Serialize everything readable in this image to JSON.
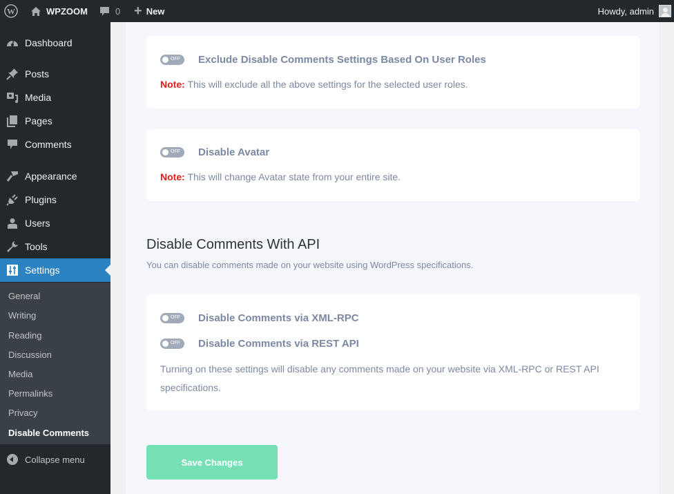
{
  "adminbar": {
    "site_name": "WPZOOM",
    "comments_count": "0",
    "new_label": "New",
    "howdy": "Howdy, admin",
    "icons": [
      "wordpress-logo-icon",
      "home-icon",
      "comment-bubble-icon",
      "plus-icon",
      "user-avatar-icon"
    ]
  },
  "sidebar": {
    "items": [
      {
        "label": "Dashboard",
        "icon": "dashboard-icon"
      },
      {
        "label": "Posts",
        "icon": "pin-icon"
      },
      {
        "label": "Media",
        "icon": "media-icon"
      },
      {
        "label": "Pages",
        "icon": "pages-icon"
      },
      {
        "label": "Comments",
        "icon": "comment-icon"
      },
      {
        "label": "Appearance",
        "icon": "paintbrush-icon"
      },
      {
        "label": "Plugins",
        "icon": "plug-icon"
      },
      {
        "label": "Users",
        "icon": "user-icon"
      },
      {
        "label": "Tools",
        "icon": "wrench-icon"
      },
      {
        "label": "Settings",
        "icon": "sliders-icon",
        "current": true
      }
    ],
    "submenu": [
      {
        "label": "General"
      },
      {
        "label": "Writing"
      },
      {
        "label": "Reading"
      },
      {
        "label": "Discussion"
      },
      {
        "label": "Media"
      },
      {
        "label": "Permalinks"
      },
      {
        "label": "Privacy"
      },
      {
        "label": "Disable Comments",
        "current": true
      }
    ],
    "collapse_label": "Collapse menu"
  },
  "main": {
    "cards": [
      {
        "toggle_state": "OFF",
        "title": "Exclude Disable Comments Settings Based On User Roles",
        "note_label": "Note:",
        "note_text": " This will exclude all the above settings for the selected user roles."
      },
      {
        "toggle_state": "OFF",
        "title": "Disable Avatar",
        "note_label": "Note:",
        "note_text": " This will change Avatar state from your entire site."
      }
    ],
    "api_section": {
      "title": "Disable Comments With API",
      "description": "You can disable comments made on your website using WordPress specifications.",
      "options": [
        {
          "toggle_state": "OFF",
          "title": "Disable Comments via XML-RPC"
        },
        {
          "toggle_state": "OFF",
          "title": "Disable Comments via REST API"
        }
      ],
      "paragraph": "Turning on these settings will disable any comments made on your website via XML-RPC or REST API specifications."
    },
    "save_label": "Save Changes"
  },
  "colors": {
    "sidebar_bg": "#23282d",
    "current_menu": "#2c83c3",
    "note_red": "#e01e1e",
    "save_button": "#74e0b4",
    "option_text": "#7b88a3"
  }
}
